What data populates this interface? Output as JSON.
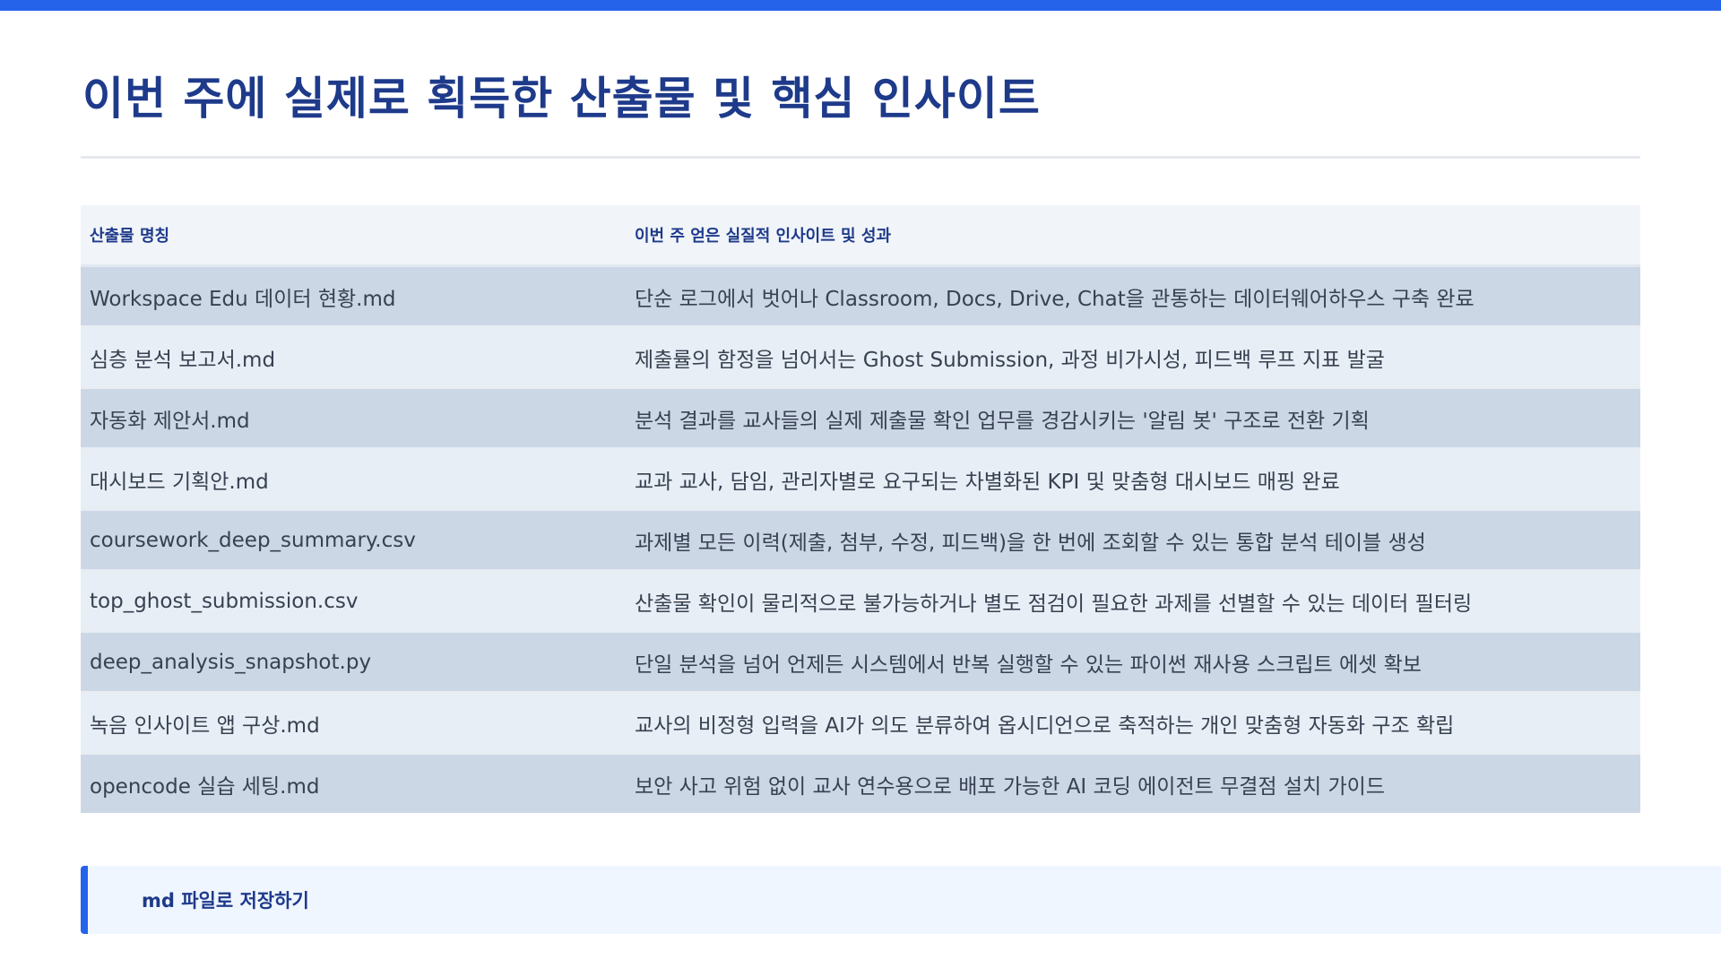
{
  "page": {
    "title": "이번 주에 실제로 획득한 산출물 및 핵심 인사이트"
  },
  "table": {
    "headers": [
      "산출물 명칭",
      "이번 주 얻은 실질적 인사이트 및 성과"
    ],
    "rows": [
      [
        "Workspace Edu 데이터 현황.md",
        "단순 로그에서 벗어나 Classroom, Docs, Drive, Chat을 관통하는 데이터웨어하우스 구축 완료"
      ],
      [
        "심층 분석 보고서.md",
        "제출률의 함정을 넘어서는 Ghost Submission, 과정 비가시성, 피드백 루프 지표 발굴"
      ],
      [
        "자동화 제안서.md",
        "분석 결과를 교사들의 실제 제출물 확인 업무를 경감시키는 '알림 봇' 구조로 전환 기획"
      ],
      [
        "대시보드 기획안.md",
        "교과 교사, 담임, 관리자별로 요구되는 차별화된 KPI 및 맞춤형 대시보드 매핑 완료"
      ],
      [
        "coursework_deep_summary.csv",
        "과제별 모든 이력(제출, 첨부, 수정, 피드백)을 한 번에 조회할 수 있는 통합 분석 테이블 생성"
      ],
      [
        "top_ghost_submission.csv",
        "산출물 확인이 물리적으로 불가능하거나 별도 점검이 필요한 과제를 선별할 수 있는 데이터 필터링"
      ],
      [
        "deep_analysis_snapshot.py",
        "단일 분석을 넘어 언제든 시스템에서 반복 실행할 수 있는 파이썬 재사용 스크립트 에셋 확보"
      ],
      [
        "녹음 인사이트 앱 구상.md",
        "교사의 비정형 입력을 AI가 의도 분류하여 옵시디언으로 축적하는 개인 맞춤형 자동화 구조 확립"
      ],
      [
        "opencode 실습 세팅.md",
        "보안 사고 위험 없이 교사 연수용으로 배포 가능한 AI 코딩 에이전트 무결점 설치 가이드"
      ]
    ]
  },
  "callout": {
    "text": "md 파일로 저장하기"
  },
  "colors": {
    "accent": "#2563eb",
    "title": "#1e3a8a",
    "row_odd": "#ccd7e6",
    "row_even": "#e8eef5"
  }
}
